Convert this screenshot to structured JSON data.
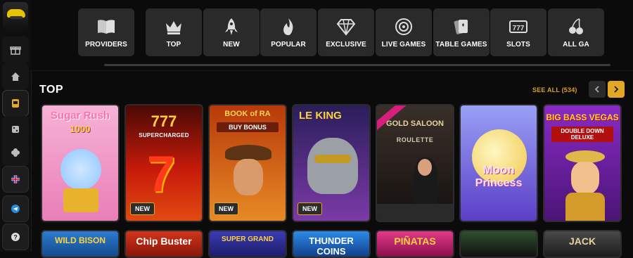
{
  "sidebar": {
    "items": [
      {
        "name": "gift-icon"
      },
      {
        "name": "home-icon"
      },
      {
        "name": "slot-machine-icon"
      },
      {
        "name": "dice-icon"
      },
      {
        "name": "clover-icon"
      },
      {
        "name": "language-flag-icon"
      },
      {
        "name": "telegram-icon"
      },
      {
        "name": "help-icon"
      }
    ]
  },
  "categories": [
    {
      "label": "PROVIDERS",
      "icon": "book-icon"
    },
    {
      "label": "TOP",
      "icon": "crown-icon"
    },
    {
      "label": "NEW",
      "icon": "rocket-icon"
    },
    {
      "label": "POPULAR",
      "icon": "flame-icon"
    },
    {
      "label": "EXCLUSIVE",
      "icon": "diamond-icon"
    },
    {
      "label": "LIVE GAMES",
      "icon": "roulette-icon"
    },
    {
      "label": "TABLE GAMES",
      "icon": "cards-icon"
    },
    {
      "label": "SLOTS",
      "icon": "777-icon"
    },
    {
      "label": "ALL GA",
      "icon": "cherry-icon"
    }
  ],
  "section": {
    "title": "TOP",
    "see_all": "SEE ALL (534)"
  },
  "games": [
    {
      "title_1": "Sugar Rush",
      "title_2": "1000",
      "badge": "",
      "bg": "#f4a0c9"
    },
    {
      "title_1": "777",
      "title_2": "SUPERCHARGED",
      "badge": "NEW",
      "bg": "#9b1408"
    },
    {
      "title_1": "BOOK of RA",
      "title_2": "BUY BONUS",
      "badge": "NEW",
      "bg": "#c2460d"
    },
    {
      "title_1": "LE KING",
      "title_2": "",
      "badge": "NEW",
      "bg": "#5f2c7a"
    },
    {
      "title_1": "GOLD SALOON",
      "title_2": "ROULETTE",
      "badge": "",
      "bg": "#2b2420"
    },
    {
      "title_1": "Moon",
      "title_2": "Princess",
      "badge": "",
      "bg": "#6f5ad8"
    },
    {
      "title_1": "BIG BASS VEGAS",
      "title_2": "DOUBLE DOWN DELUXE",
      "badge": "",
      "bg": "#7b2aa0"
    }
  ],
  "games_row2": [
    {
      "title": "WILD BISON",
      "bg": "#1f5fa3"
    },
    {
      "title": "Chip Buster",
      "bg": "#b8260f"
    },
    {
      "title": "SUPER GRAND",
      "bg": "#2a2a8a"
    },
    {
      "title": "THUNDER COINS",
      "bg": "#1b5fc7"
    },
    {
      "title": "PIÑATAS",
      "bg": "#c2186f"
    },
    {
      "title": "",
      "bg": "#1f3b1f"
    },
    {
      "title": "JACK",
      "bg": "#3b3b3b"
    }
  ]
}
